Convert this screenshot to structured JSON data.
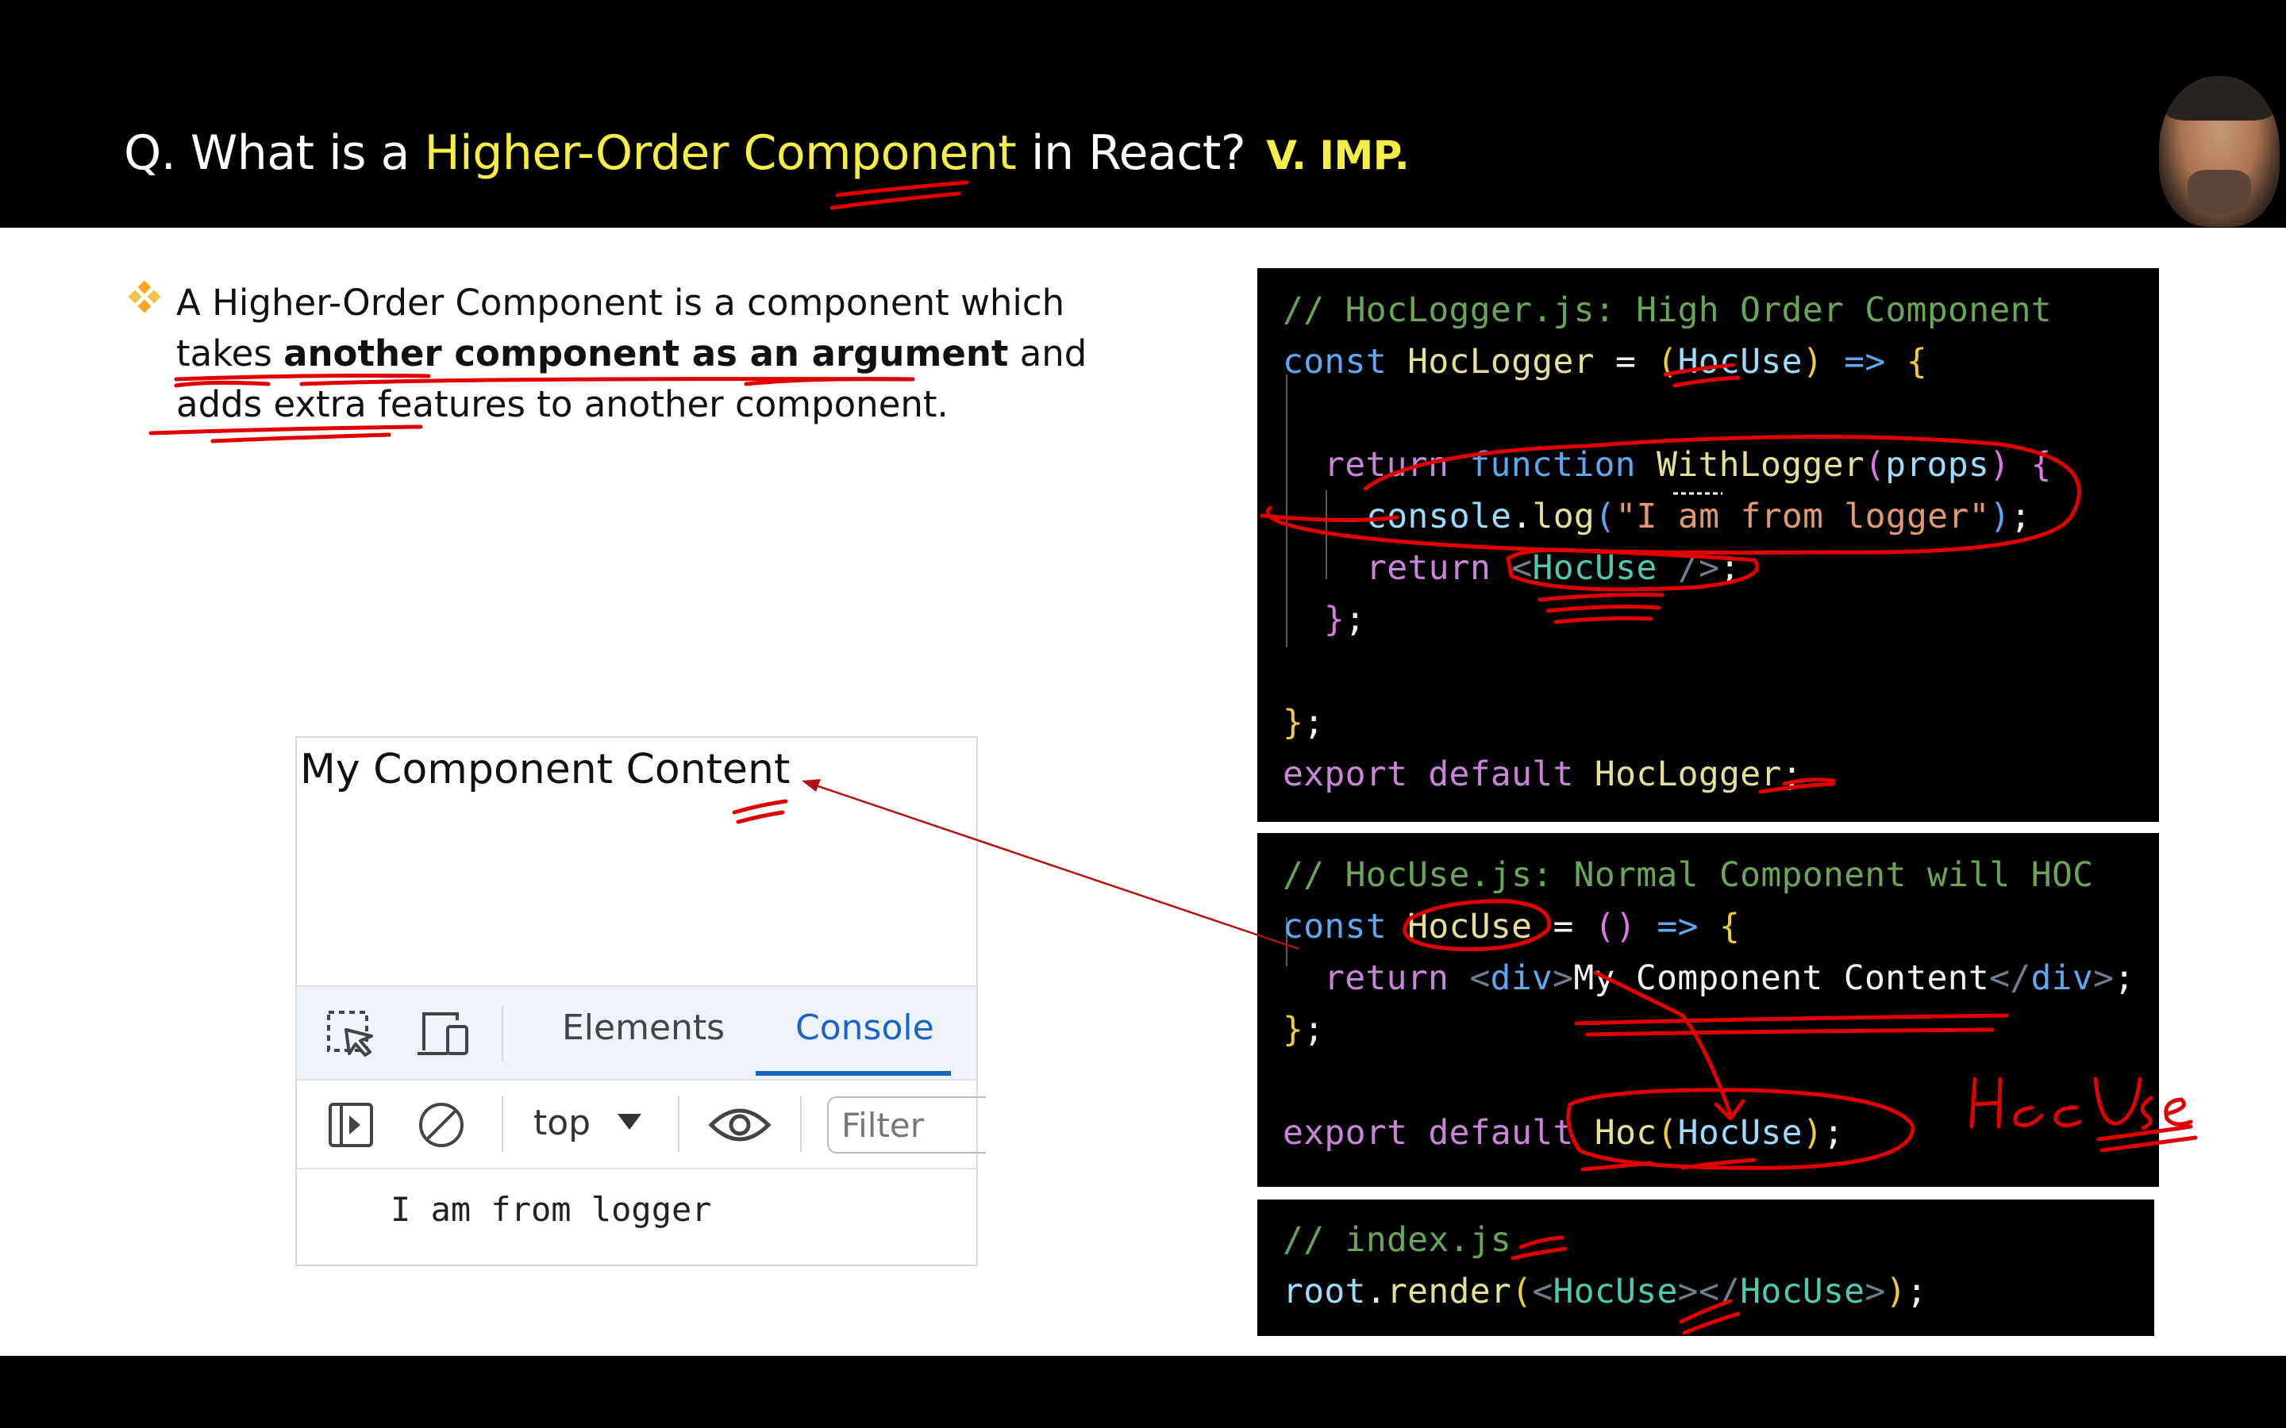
{
  "title": {
    "prefix": "Q. What is a ",
    "highlight": "Higher-Order Component",
    "suffix": " in React?",
    "badge": "V. IMP."
  },
  "bullet": {
    "t1": "A Higher-Order Component is a component which takes ",
    "t2": "another component as an argument",
    "t3": " and adds extra features to another component."
  },
  "browser": {
    "content": "My Component Content",
    "tabs": [
      "Elements",
      "Console"
    ],
    "context": "top",
    "filter_placeholder": "Filter",
    "console_output": "I am from logger"
  },
  "code1": {
    "comment": "// HocLogger.js: High Order Component",
    "l2": {
      "kw": "const",
      "name": "HocLogger",
      "eq": " = ",
      "p1": "(",
      "arg": "HocUse",
      "p2": ")",
      "arrow": " => ",
      "b": "{"
    },
    "l4": {
      "ret": "return",
      "fn": "function",
      "name": "WithLogger",
      "p1": "(",
      "arg": "props",
      "p2": ")",
      "b": " {"
    },
    "l5": {
      "obj": "console",
      "dot": ".",
      "m": "log",
      "p1": "(",
      "str": "\"I am from logger\"",
      "p2": ")",
      "end": ";"
    },
    "l6": {
      "ret": "return",
      "lt": "<",
      "comp": "HocUse",
      "gt": " />",
      "end": ";"
    },
    "l7": {
      "b": "}",
      "end": ";"
    },
    "l9": {
      "b": "}",
      "end": ";"
    },
    "l10": {
      "exp": "export",
      "def": "default",
      "name": "HocLogger",
      "end": ";"
    }
  },
  "code2": {
    "comment": "// HocUse.js: Normal Component will HOC",
    "l2": {
      "kw": "const",
      "name": "HocUse",
      "eq": " = ",
      "p": "()",
      "arrow": " => ",
      "b": "{"
    },
    "l3": {
      "ret": "return",
      "o1": "<",
      "tag": "div",
      "o2": ">",
      "text": "My Component Content",
      "c1": "</",
      "c2": ">",
      "end": ";"
    },
    "l4": {
      "b": "}",
      "end": ";"
    },
    "l6": {
      "exp": "export",
      "def": "default",
      "fn": "Hoc",
      "p1": "(",
      "arg": "HocUse",
      "p2": ")",
      "end": ";"
    }
  },
  "code3": {
    "comment": "// index.js",
    "l2": {
      "obj": "root",
      "dot": ".",
      "m": "render",
      "p1": "(",
      "o1": "<",
      "comp": "HocUse",
      "o2": "></",
      "c2": ">",
      "p2": ")",
      "end": ";"
    }
  },
  "annotations": {
    "handwriting": "HocUse"
  },
  "colors": {
    "title_highlight": "#f3ef45",
    "ink": "#e00000",
    "console_tab": "#1a64c8",
    "bullet_diamond": "#f5a623"
  }
}
